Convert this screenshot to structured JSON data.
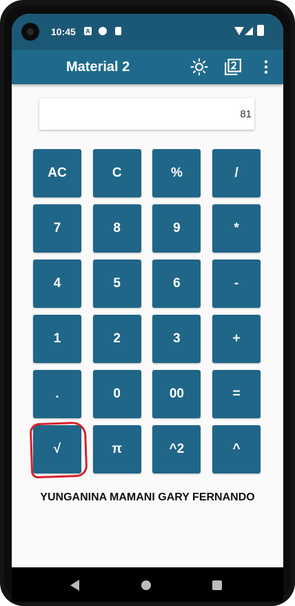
{
  "status_bar": {
    "time": "10:45",
    "notification_a": "A"
  },
  "app_bar": {
    "title": "Material 2"
  },
  "display": {
    "value": "81"
  },
  "keypad": {
    "rows": [
      [
        "AC",
        "C",
        "%",
        "/"
      ],
      [
        "7",
        "8",
        "9",
        "*"
      ],
      [
        "4",
        "5",
        "6",
        "-"
      ],
      [
        "1",
        "2",
        "3",
        "+"
      ],
      [
        ".",
        "0",
        "00",
        "="
      ],
      [
        "√",
        "π",
        "^2",
        "^"
      ]
    ]
  },
  "author": "YUNGANINA MAMANI GARY FERNANDO",
  "colors": {
    "status_bar": "#1b5875",
    "app_bar": "#1f6a8c",
    "key": "#206688",
    "highlight": "#d6222b"
  },
  "icons": [
    "wifi-icon",
    "signal-icon",
    "battery-icon",
    "brightness-icon",
    "filter-2-icon",
    "more-vert-icon"
  ]
}
